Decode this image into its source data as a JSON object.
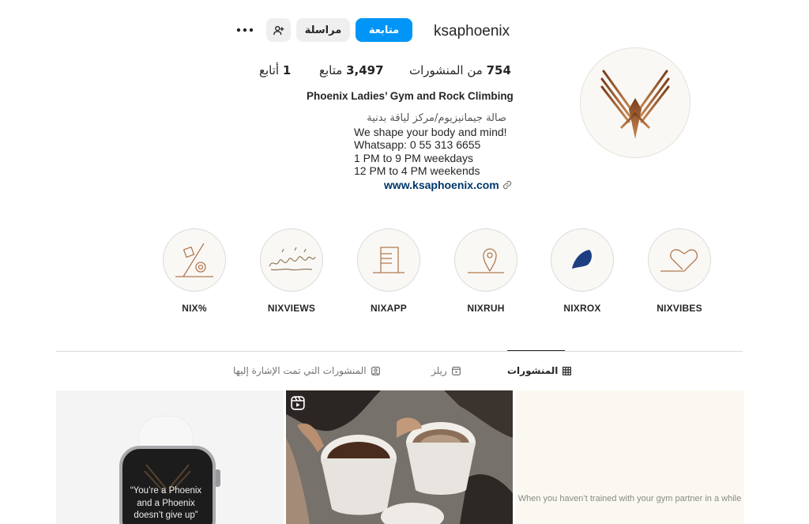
{
  "profile": {
    "username": "ksaphoenix",
    "buttons": {
      "follow": "متابعة",
      "message": "مراسلة"
    },
    "stats": {
      "posts_count": "754",
      "posts_label": "من المنشورات",
      "followers_count": "3,497",
      "followers_label": "متابع",
      "following_count": "1",
      "following_label": "أتابع"
    },
    "full_name": "Phoenix Ladies’ Gym and Rock Climbing",
    "bio": {
      "category": "صالة جيمانيزيوم/مركز لياقة بدنية",
      "lines": [
        "We shape your body and mind!",
        "Whatsapp: 0 55 313 6655",
        "1 PM to 9 PM weekdays",
        "12 PM to 4 PM weekends"
      ]
    },
    "website": "www.ksaphoenix.com"
  },
  "highlights": [
    {
      "label": "NIXVIBES",
      "icon": "heart-line-icon"
    },
    {
      "label": "NIXROX",
      "icon": "climbing-hold-icon"
    },
    {
      "label": "NIXRUH",
      "icon": "map-pin-icon"
    },
    {
      "label": "NIXAPP",
      "icon": "app-lines-icon"
    },
    {
      "label": "NIXVIEWS",
      "icon": "script-doodle-icon"
    },
    {
      "label": "NIX%",
      "icon": "percent-icon"
    }
  ],
  "tabs": [
    {
      "label": "المنشورات",
      "icon": "grid-icon",
      "active": true
    },
    {
      "label": "ريلز",
      "icon": "reels-icon",
      "active": false
    },
    {
      "label": "المنشورات التي تمت الإشارة إليها",
      "icon": "tagged-icon",
      "active": false
    }
  ],
  "posts": [
    {
      "text": "“You’re a Phoenix and a Phoenix doesn’t give up”"
    },
    {
      "badge": "reel-icon"
    },
    {
      "text": "When you haven’t trained with your gym partner in a while"
    }
  ],
  "colors": {
    "accent": "#0095f6",
    "brand_copper": "#a0623a",
    "link": "#00376b",
    "text": "#262626",
    "muted": "#737373"
  }
}
